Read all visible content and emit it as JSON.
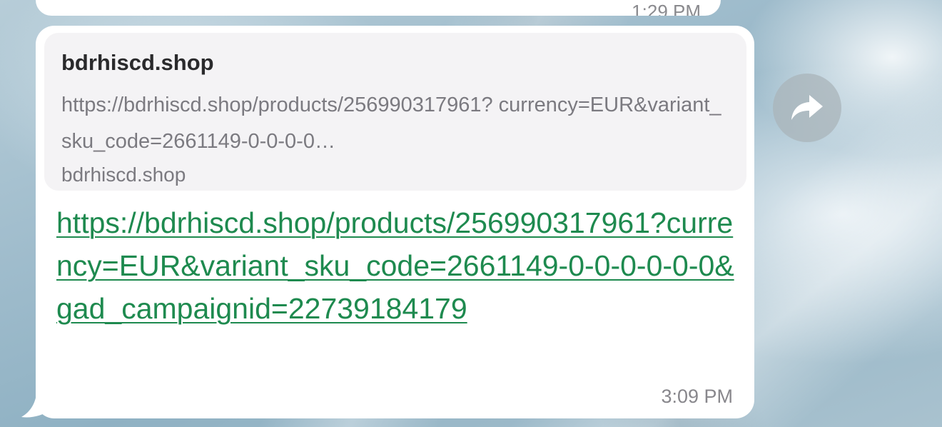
{
  "previous_message": {
    "time_label": "1:29 PM"
  },
  "message": {
    "link_preview": {
      "site_name": "bdrhiscd.shop",
      "description": "https://bdrhiscd.shop/products/256990317961? currency=EUR&variant_sku_code=2661149-0-0-0-0…",
      "domain": "bdrhiscd.shop"
    },
    "link_text": "https://bdrhiscd.shop/products/256990317961?currency=EUR&variant_sku_code=2661149-0-0-0-0-0-0&gad_campaignid=22739184179",
    "time": "3:09 PM"
  },
  "actions": {
    "forward_icon": "forward-arrow-icon"
  },
  "colors": {
    "link": "#1e8a4f",
    "bubble": "#ffffff",
    "preview_bg": "#f4f3f5"
  }
}
